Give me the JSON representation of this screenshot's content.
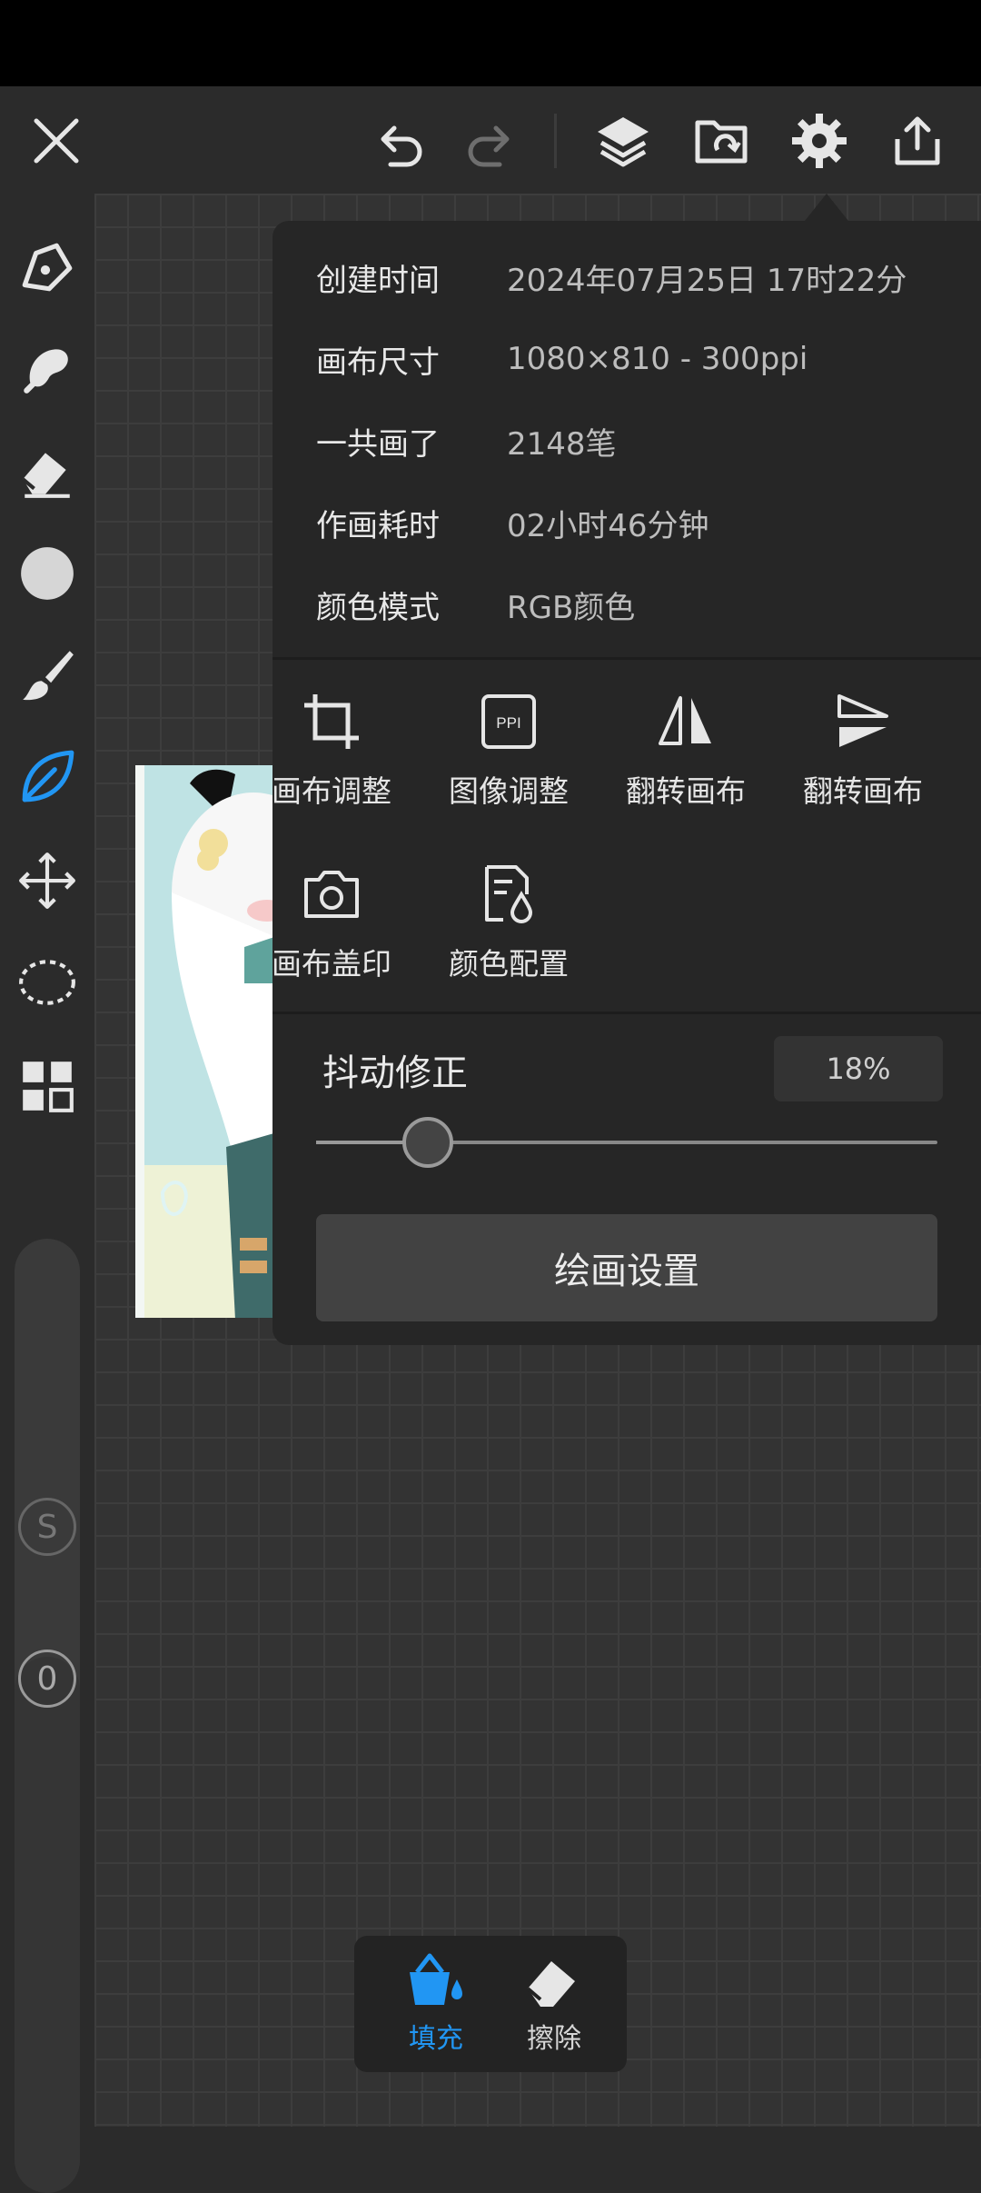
{
  "toolbar": {
    "icons": [
      "close-icon",
      "undo-icon",
      "redo-icon",
      "layers-icon",
      "save-to-folder-icon",
      "settings-icon",
      "share-icon"
    ]
  },
  "sidebar": {
    "tools": [
      "pen-icon",
      "smudge-icon",
      "eraser-icon",
      "color-circle-icon",
      "brush-icon",
      "fill-leaf-icon",
      "move-icon",
      "lasso-icon",
      "grid-menu-icon"
    ],
    "active_tool": "fill-leaf-icon",
    "size_indicator": "S",
    "opacity_indicator": "0"
  },
  "info": [
    {
      "key": "创建时间",
      "value": "2024年07月25日 17时22分"
    },
    {
      "key": "画布尺寸",
      "value": "1080×810 - 300ppi"
    },
    {
      "key": "一共画了",
      "value": "2148笔"
    },
    {
      "key": "作画耗时",
      "value": "02小时46分钟"
    },
    {
      "key": "颜色模式",
      "value": "RGB颜色"
    }
  ],
  "tools": [
    {
      "label": "画布调整",
      "icon": "crop-icon"
    },
    {
      "label": "图像调整",
      "icon": "ppi-icon"
    },
    {
      "label": "翻转画布",
      "icon": "flip-horizontal-icon"
    },
    {
      "label": "翻转画布",
      "icon": "flip-vertical-icon"
    },
    {
      "label": "画布盖印",
      "icon": "camera-icon"
    },
    {
      "label": "颜色配置",
      "icon": "color-profile-icon"
    }
  ],
  "stabilizer": {
    "label": "抖动修正",
    "value": "18%",
    "level": 0.18
  },
  "paint_settings_label": "绘画设置",
  "bottom": {
    "fill_label": "填充",
    "erase_label": "擦除"
  },
  "colors": {
    "accent": "#2196f3",
    "panel": "#262626",
    "background": "#2b2b2b"
  }
}
